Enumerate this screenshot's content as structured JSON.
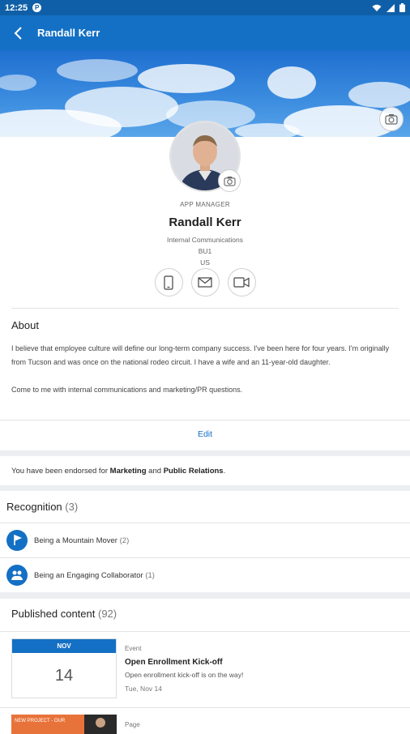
{
  "status_bar": {
    "time": "12:25",
    "app_icon": "P"
  },
  "app_bar": {
    "title": "Randall Kerr"
  },
  "profile": {
    "role": "APP MANAGER",
    "name": "Randall Kerr",
    "department": "Internal Communications",
    "unit": "BU1",
    "country": "US"
  },
  "about": {
    "title": "About",
    "paragraph1": "I believe that employee culture will define our long-term company success. I've been here for four years. I'm originally from Tucson and was once on the national rodeo circuit. I have a wife and an 11-year-old daughter.",
    "paragraph2": "Come to me with internal communications and marketing/PR questions.",
    "edit_label": "Edit"
  },
  "endorsement": {
    "prefix": "You have been endorsed for ",
    "skill1": "Marketing",
    "joiner": " and ",
    "skill2": "Public Relations",
    "suffix": "."
  },
  "recognition": {
    "title": "Recognition",
    "count": "(3)",
    "items": [
      {
        "label": "Being a Mountain Mover",
        "count": "(2)"
      },
      {
        "label": "Being an Engaging Collaborator",
        "count": "(1)"
      }
    ]
  },
  "published": {
    "title": "Published content",
    "count": "(92)",
    "items": [
      {
        "month": "NOV",
        "day": "14",
        "type": "Event",
        "title": "Open Enrollment Kick-off",
        "description": "Open enrollment kick-off is on the way!",
        "date": "Tue, Nov 14"
      },
      {
        "type": "Page",
        "thumb_text": "NEW PROJECT - OUR"
      }
    ]
  },
  "colors": {
    "brand": "#1470c4",
    "status_bar": "#0f5fa8"
  }
}
